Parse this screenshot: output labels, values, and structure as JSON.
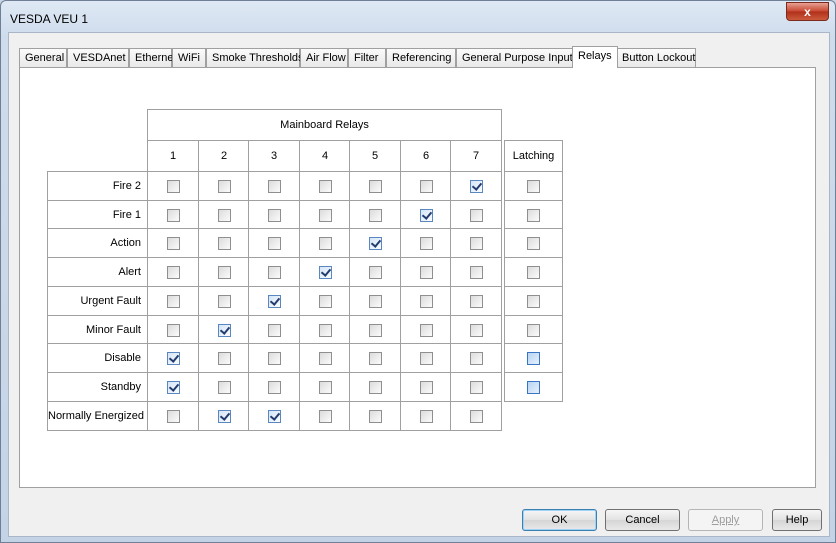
{
  "window": {
    "title": "VESDA VEU  1",
    "close_label": "x"
  },
  "tabs": [
    {
      "label": "General",
      "active": false
    },
    {
      "label": "VESDAnet",
      "active": false
    },
    {
      "label": "Ethernet",
      "active": false
    },
    {
      "label": "WiFi",
      "active": false
    },
    {
      "label": "Smoke Thresholds",
      "active": false
    },
    {
      "label": "Air Flow",
      "active": false
    },
    {
      "label": "Filter",
      "active": false
    },
    {
      "label": "Referencing",
      "active": false
    },
    {
      "label": "General Purpose Inputs",
      "active": false
    },
    {
      "label": "Relays",
      "active": true
    },
    {
      "label": "Button Lockout",
      "active": false
    }
  ],
  "relays": {
    "group_header": "Mainboard Relays",
    "columns": [
      "1",
      "2",
      "3",
      "4",
      "5",
      "6",
      "7"
    ],
    "latching_header": "Latching",
    "rows": [
      {
        "label": "Fire 2",
        "relays": [
          false,
          false,
          false,
          false,
          false,
          false,
          true
        ],
        "latching": false,
        "latching_highlight": false
      },
      {
        "label": "Fire 1",
        "relays": [
          false,
          false,
          false,
          false,
          false,
          true,
          false
        ],
        "latching": false,
        "latching_highlight": false
      },
      {
        "label": "Action",
        "relays": [
          false,
          false,
          false,
          false,
          true,
          false,
          false
        ],
        "latching": false,
        "latching_highlight": false
      },
      {
        "label": "Alert",
        "relays": [
          false,
          false,
          false,
          true,
          false,
          false,
          false
        ],
        "latching": false,
        "latching_highlight": false
      },
      {
        "label": "Urgent Fault",
        "relays": [
          false,
          false,
          true,
          false,
          false,
          false,
          false
        ],
        "latching": false,
        "latching_highlight": false
      },
      {
        "label": "Minor Fault",
        "relays": [
          false,
          true,
          false,
          false,
          false,
          false,
          false
        ],
        "latching": false,
        "latching_highlight": false
      },
      {
        "label": "Disable",
        "relays": [
          true,
          false,
          false,
          false,
          false,
          false,
          false
        ],
        "latching": false,
        "latching_highlight": true
      },
      {
        "label": "Standby",
        "relays": [
          true,
          false,
          false,
          false,
          false,
          false,
          false
        ],
        "latching": false,
        "latching_highlight": true
      },
      {
        "label": "Normally Energized",
        "relays": [
          false,
          true,
          true,
          false,
          false,
          false,
          false
        ],
        "latching": null,
        "latching_highlight": false
      }
    ]
  },
  "buttons": {
    "ok": "OK",
    "cancel": "Cancel",
    "apply": "Apply",
    "help": "Help"
  }
}
